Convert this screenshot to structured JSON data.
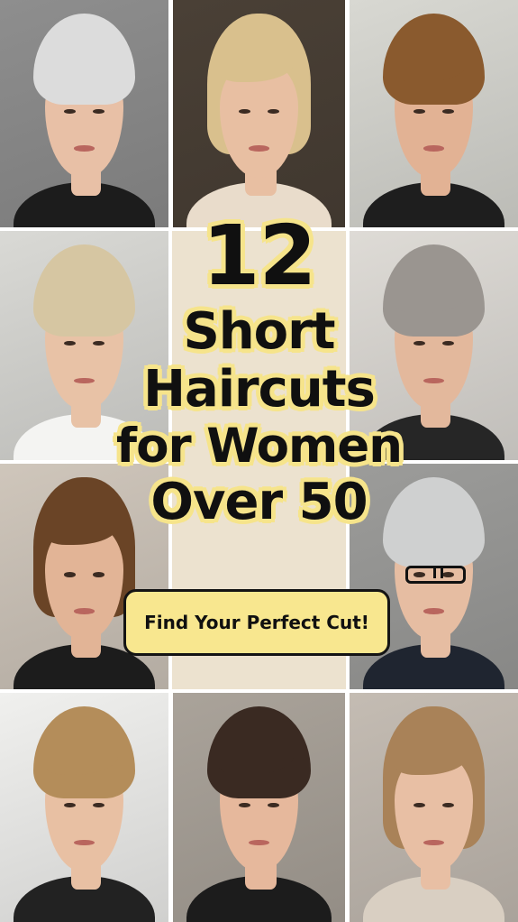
{
  "title": {
    "number": "12",
    "line1": "Short",
    "line2": "Haircuts",
    "line3": "for Women",
    "line4": "Over 50"
  },
  "cta": {
    "label": "Find Your Perfect Cut!"
  },
  "colors": {
    "title_text": "#101010",
    "title_outline": "#f6e48b",
    "cta_background": "#f8e78f",
    "panel": "#ece2cf"
  },
  "portraits": [
    {
      "style": "silver pixie",
      "hair": "#dcdcdc",
      "bg": "#8e8e8e",
      "top": "#1c1c1c",
      "skin": "#e8c0a6",
      "shape": "pixie"
    },
    {
      "style": "blonde bob",
      "hair": "#d9c08d",
      "bg": "#4a4036",
      "top": "#e9dccb",
      "skin": "#e8bfa2",
      "shape": "bob"
    },
    {
      "style": "brown pixie",
      "hair": "#8a5a2e",
      "bg": "#d8d8d2",
      "top": "#1e1e1e",
      "skin": "#e2b294",
      "shape": "pixie"
    },
    {
      "style": "blonde feathered pixie",
      "hair": "#d6c6a2",
      "bg": "#d9d9d5",
      "top": "#f4f4f2",
      "skin": "#e8c2a6",
      "shape": "pixie"
    },
    {
      "style": "gray shag",
      "hair": "#9a9590",
      "bg": "#dedbd6",
      "top": "#262626",
      "skin": "#e3b89c",
      "shape": "pixie"
    },
    {
      "style": "brown bob",
      "hair": "#6a4426",
      "bg": "#cfc6bb",
      "top": "#1c1c1c",
      "skin": "#e2b496",
      "shape": "bob"
    },
    {
      "style": "silver pixie with glasses",
      "hair": "#cfd0d0",
      "bg": "#9c9c9a",
      "top": "#1f2530",
      "skin": "#e6bda2",
      "shape": "pixie",
      "glasses": true
    },
    {
      "style": "tousled blonde pixie",
      "hair": "#b48d5a",
      "bg": "#f0f0ee",
      "top": "#222222",
      "skin": "#e8c0a3",
      "shape": "pixie"
    },
    {
      "style": "dark layered pixie",
      "hair": "#3a2a22",
      "bg": "#aaa39a",
      "top": "#1c1c1c",
      "skin": "#e6b89c",
      "shape": "pixie"
    },
    {
      "style": "highlighted bob",
      "hair": "#a98258",
      "bg": "#c4bcb3",
      "top": "#d9cfc2",
      "skin": "#e8bfa4",
      "shape": "bob"
    }
  ]
}
